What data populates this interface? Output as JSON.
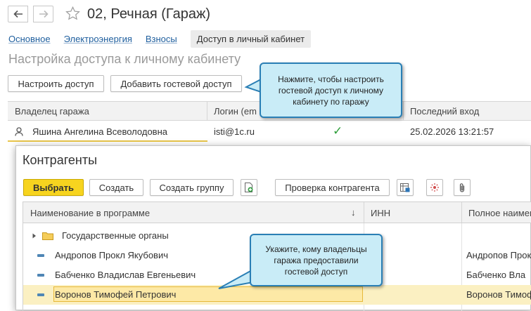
{
  "window": {
    "title": "02, Речная (Гараж)"
  },
  "tabs": [
    {
      "label": "Основное"
    },
    {
      "label": "Электроэнергия"
    },
    {
      "label": "Взносы"
    },
    {
      "label": "Доступ в личный кабинет"
    }
  ],
  "section": {
    "title": "Настройка доступа к личному кабинету"
  },
  "toolbar": {
    "configure_label": "Настроить доступ",
    "add_guest_label": "Добавить гостевой доступ"
  },
  "access_table": {
    "columns": [
      "Владелец гаража",
      "Логин (em",
      "",
      "Последний вход"
    ],
    "rows": [
      {
        "owner": "Яшина Ангелина Всеволодовна",
        "login": "isti@1c.ru",
        "check": "✓",
        "last_login": "25.02.2026 13:21:57"
      }
    ]
  },
  "dialog": {
    "title": "Контрагенты",
    "buttons": {
      "select": "Выбрать",
      "create": "Создать",
      "create_group": "Создать группу",
      "check": "Проверка контрагента"
    },
    "columns": [
      "Наименование в программе",
      "↓",
      "ИНН",
      "Полное наимен"
    ],
    "rows": [
      {
        "name": "Государственные органы",
        "inn": "",
        "full": ""
      },
      {
        "name": "Андропов Прокл Якубович",
        "inn": "",
        "full": "Андропов Прок"
      },
      {
        "name": "Бабченко Владислав Евгеньевич",
        "inn": "",
        "full": "Бабченко Вла"
      },
      {
        "name": "Воронов Тимофей Петрович",
        "inn": "",
        "full": "Воронов Тимоф"
      }
    ]
  },
  "callouts": {
    "top": "Нажмите, чтобы настроить гостевой доступ к личному кабинету по гаражу",
    "bottom": "Укажите, кому владельцы гаража предоставили гостевой доступ"
  },
  "colors": {
    "accent_yellow": "#f7d41f",
    "link_blue": "#1f5f9e",
    "callout_bg": "#c9ecf7",
    "callout_border": "#2a7fb5",
    "check_green": "#2e9e3a"
  },
  "icons": [
    "back-arrow-icon",
    "forward-arrow-icon",
    "star-icon",
    "person-icon",
    "check-icon",
    "folder-icon",
    "expand-arrow-icon",
    "add-doc-icon",
    "table-icon",
    "bookmark-icon",
    "paperclip-icon"
  ]
}
